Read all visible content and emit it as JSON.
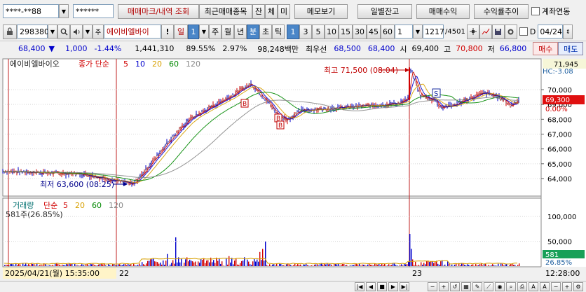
{
  "toolbar1": {
    "account": "****-**88",
    "password": "******",
    "mark_btn": "매매마크/내역 조회",
    "recent_btn": "최근매매종목",
    "tab_balance": "잔",
    "tab_exec": "체",
    "tab_unexec": "미",
    "memo_btn": "메모보기",
    "daily_btn": "일별잔고",
    "profit_btn": "매매수익",
    "trend_btn": "수익률추이",
    "link_label": "계좌연동"
  },
  "toolbar2": {
    "code": "298380",
    "stock_name": "에이비엘바이",
    "period_day": "일",
    "period_num": "1",
    "week": "주",
    "month": "월",
    "year": "년",
    "minute": "분",
    "second": "초",
    "tick": "틱",
    "intervals": [
      "1",
      "3",
      "5",
      "10",
      "15",
      "30",
      "45",
      "60"
    ],
    "interval_input": "1",
    "count": "1217",
    "count_total": "/4501",
    "d_label": "D",
    "date": "04/24",
    "exclaim": "!"
  },
  "quote": {
    "price": "68,400",
    "arrow": "▼",
    "change": "1,000",
    "change_pct": "-1.44%",
    "volume": "1,441,310",
    "ratio1": "89.55%",
    "ratio2": "2.97%",
    "amount": "98,248백만",
    "best_label": "최우선",
    "ask": "68,500",
    "bid": "68,400",
    "open_label": "시",
    "open": "69,400",
    "high_label": "고",
    "high": "70,800",
    "low_label": "저",
    "low": "66,800",
    "buy_btn": "매수",
    "sell_btn": "매도"
  },
  "price_panel": {
    "title": "에이비엘바이오",
    "ma_label": "종가 단순",
    "ma": [
      "5",
      "10",
      "20",
      "60",
      "120"
    ],
    "ma_colors": [
      "#d00000",
      "#0000cc",
      "#d8a000",
      "#008800",
      "#888888"
    ],
    "max_text": "최고 71,500 (08:04)",
    "min_text": "최저 63,600 (08:25)",
    "axis_top": "71,945",
    "axis_hc": "HC:-3.08",
    "axis_ticks": [
      "70,000",
      "69,000",
      "68,000",
      "67,000",
      "66,000",
      "65,000",
      "64,000"
    ],
    "current_price": "69,300",
    "current_pct": "0.00%",
    "marker_s": "S",
    "marker_b": "B"
  },
  "volume_panel": {
    "title": "거래량",
    "ma_label": "단순",
    "ma": [
      "5",
      "20",
      "60",
      "120"
    ],
    "ma_colors": [
      "#d00000",
      "#d8a000",
      "#008800",
      "#888888"
    ],
    "value_text": "581주(26.85%)",
    "axis_ticks": [
      "100,000",
      "50,000"
    ],
    "current": "581",
    "pct": "26.85%"
  },
  "xaxis": {
    "start_label": "2025/04/21(월) 15:35:00",
    "label_22": "22",
    "label_23": "23",
    "time": "12:28:00"
  },
  "chart_data": {
    "type": "line",
    "title": "에이비엘바이오",
    "x": [
      "04/21 15:35",
      "04/22",
      "04/23",
      "04/24 12:28"
    ],
    "ylim": [
      63300,
      71945
    ],
    "series": [
      {
        "name": "종가",
        "values": [
          64500,
          64400,
          64300,
          63600,
          65000,
          66500,
          68000,
          68800,
          69600,
          70400,
          69300,
          68200,
          68000,
          68600,
          68700,
          68800,
          68900,
          69000,
          69100,
          69300,
          69500,
          71500,
          69600,
          69300,
          68800,
          69000,
          69400,
          69800,
          69600,
          69300,
          68900,
          69300
        ]
      }
    ],
    "volume_ylim": [
      0,
      130000
    ],
    "max": {
      "value": 71500,
      "time": "08:04"
    },
    "min": {
      "value": 63600,
      "time": "08:25"
    }
  }
}
